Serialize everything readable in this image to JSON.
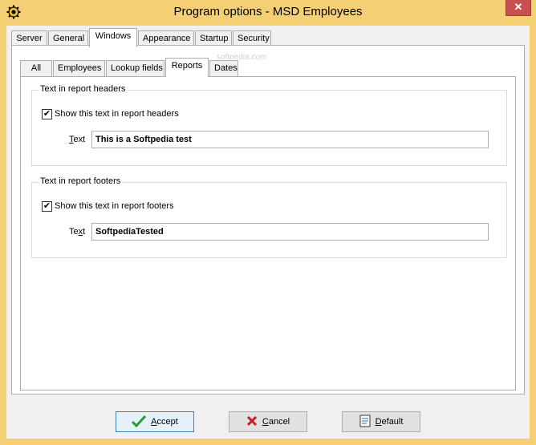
{
  "window": {
    "title": "Program options - MSD Employees",
    "close_label": "✕"
  },
  "outer_tabs": [
    {
      "label": "Server"
    },
    {
      "label": "General"
    },
    {
      "label": "Windows"
    },
    {
      "label": "Appearance"
    },
    {
      "label": "Startup"
    },
    {
      "label": "Security"
    }
  ],
  "inner_tabs": [
    {
      "label": "All"
    },
    {
      "label": "Employees"
    },
    {
      "label": "Lookup fields"
    },
    {
      "label": "Reports"
    },
    {
      "label": "Dates"
    }
  ],
  "watermark": "softpedia.com",
  "header_group": {
    "title": "Text in report headers",
    "checkbox_label": "Show this text in report headers",
    "checked": true,
    "text_label_first": "T",
    "text_label_rest": "ext",
    "text_value": "This is a Softpedia test"
  },
  "footer_group": {
    "title": "Text in report footers",
    "checkbox_label": "Show this text in report footers",
    "checked": true,
    "text_label_first": "Te",
    "text_label_u": "x",
    "text_label_rest": "t",
    "text_value": "SoftpediaTested"
  },
  "buttons": {
    "accept_first": "A",
    "accept_rest": "ccept",
    "cancel_first": "C",
    "cancel_rest": "ancel",
    "default_first": "D",
    "default_rest": "efault"
  },
  "colors": {
    "frame": "#f5cf74",
    "close": "#c74f50",
    "accept_icon": "#2e9b2e",
    "cancel_icon": "#c81e1e"
  },
  "icons": {
    "app": "gear-icon",
    "accept": "checkmark-icon",
    "cancel": "x-icon",
    "default": "document-icon"
  }
}
